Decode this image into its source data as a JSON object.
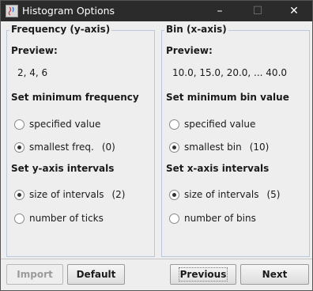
{
  "window": {
    "title": "Histogram Options"
  },
  "frequency": {
    "legend": "Frequency  (y-axis)",
    "preview_label": "Preview:",
    "preview_value": "2, 4, 6",
    "min_label": "Set minimum frequency",
    "min_options": [
      {
        "label": "specified value",
        "extra": "",
        "selected": false
      },
      {
        "label": "smallest freq.",
        "extra": "(0)",
        "selected": true
      }
    ],
    "interval_label": "Set y-axis intervals",
    "interval_options": [
      {
        "label": "size of intervals",
        "extra": "(2)",
        "selected": true
      },
      {
        "label": "number of ticks",
        "extra": "",
        "selected": false
      }
    ]
  },
  "bin": {
    "legend": "Bin  (x-axis)",
    "preview_label": "Preview:",
    "preview_value": "10.0, 15.0, 20.0, ... 40.0",
    "min_label": "Set minimum bin value",
    "min_options": [
      {
        "label": "specified value",
        "extra": "",
        "selected": false
      },
      {
        "label": "smallest bin",
        "extra": "(10)",
        "selected": true
      }
    ],
    "interval_label": "Set x-axis intervals",
    "interval_options": [
      {
        "label": "size of intervals",
        "extra": "(5)",
        "selected": true
      },
      {
        "label": "number of bins",
        "extra": "",
        "selected": false
      }
    ]
  },
  "buttons": {
    "import": "Import",
    "default": "Default",
    "previous": "Previous",
    "next": "Next"
  }
}
